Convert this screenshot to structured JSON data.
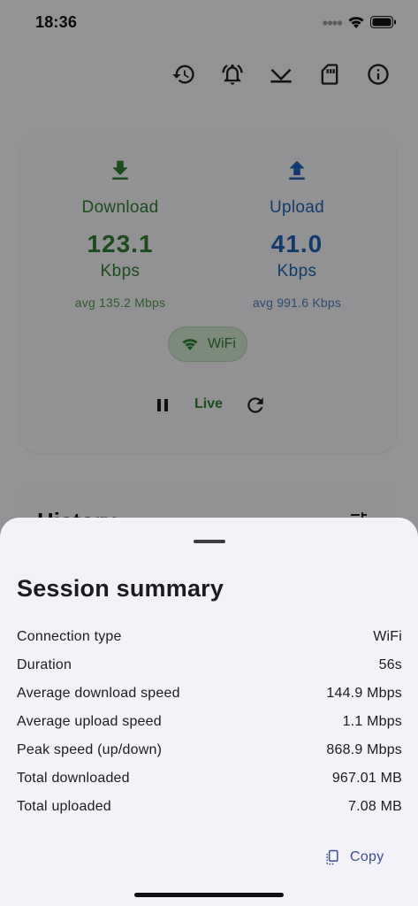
{
  "status_bar": {
    "time": "18:36"
  },
  "toolbar": {
    "icons": [
      "history-icon",
      "alarm-icon",
      "network-check-icon",
      "sd-card-icon",
      "info-icon"
    ]
  },
  "speed": {
    "download": {
      "label": "Download",
      "value": "123.1",
      "unit": "Kbps",
      "average": "avg 135.2 Mbps"
    },
    "upload": {
      "label": "Upload",
      "value": "41.0",
      "unit": "Kbps",
      "average": "avg 991.6 Kbps"
    },
    "connection_chip": "WiFi",
    "live_label": "Live"
  },
  "history": {
    "title": "History"
  },
  "sheet": {
    "title": "Session summary",
    "rows": [
      {
        "label": "Connection type",
        "value": "WiFi"
      },
      {
        "label": "Duration",
        "value": "56s"
      },
      {
        "label": "Average download speed",
        "value": "144.9 Mbps"
      },
      {
        "label": "Average upload speed",
        "value": "1.1 Mbps"
      },
      {
        "label": "Peak speed (up/down)",
        "value": "868.9 Mbps"
      },
      {
        "label": "Total downloaded",
        "value": "967.01 MB"
      },
      {
        "label": "Total uploaded",
        "value": "7.08 MB"
      }
    ],
    "copy_label": "Copy"
  },
  "colors": {
    "download": "#2f7d32",
    "upload": "#1f63b5",
    "copy_accent": "#3f4f8f"
  }
}
